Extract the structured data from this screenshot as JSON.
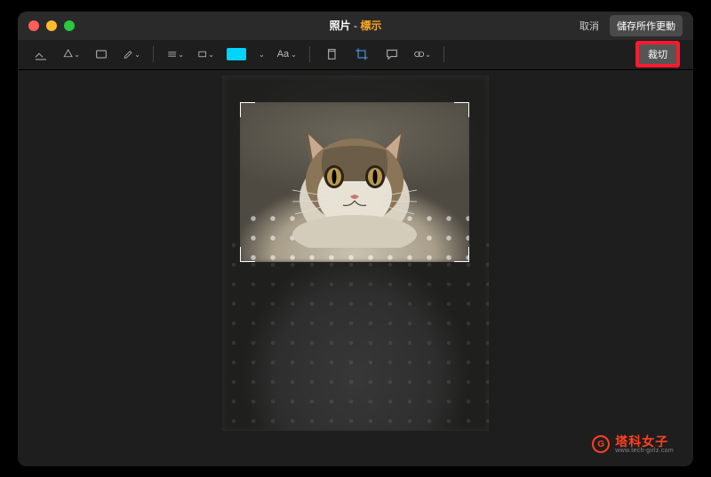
{
  "titlebar": {
    "app_name": "照片",
    "separator": " - ",
    "mode": "標示",
    "cancel_label": "取消",
    "save_label": "儲存所作更動"
  },
  "toolbar": {
    "text_label": "Aa",
    "crop_action_label": "裁切",
    "color_swatch": "#00d4ff",
    "icons": {
      "markup": "markup-icon",
      "shapes": "shapes-icon",
      "rect": "rectangle-icon",
      "draw": "draw-icon",
      "line": "line-style-icon",
      "border": "border-style-icon",
      "color": "color-icon",
      "text": "text-icon",
      "copy": "copy-icon",
      "crop": "crop-icon",
      "comment": "comment-icon",
      "adjust": "adjust-icon"
    }
  },
  "watermark": {
    "text": "塔科女子",
    "sub": "www.tech-girlz.com",
    "badge": "G"
  }
}
